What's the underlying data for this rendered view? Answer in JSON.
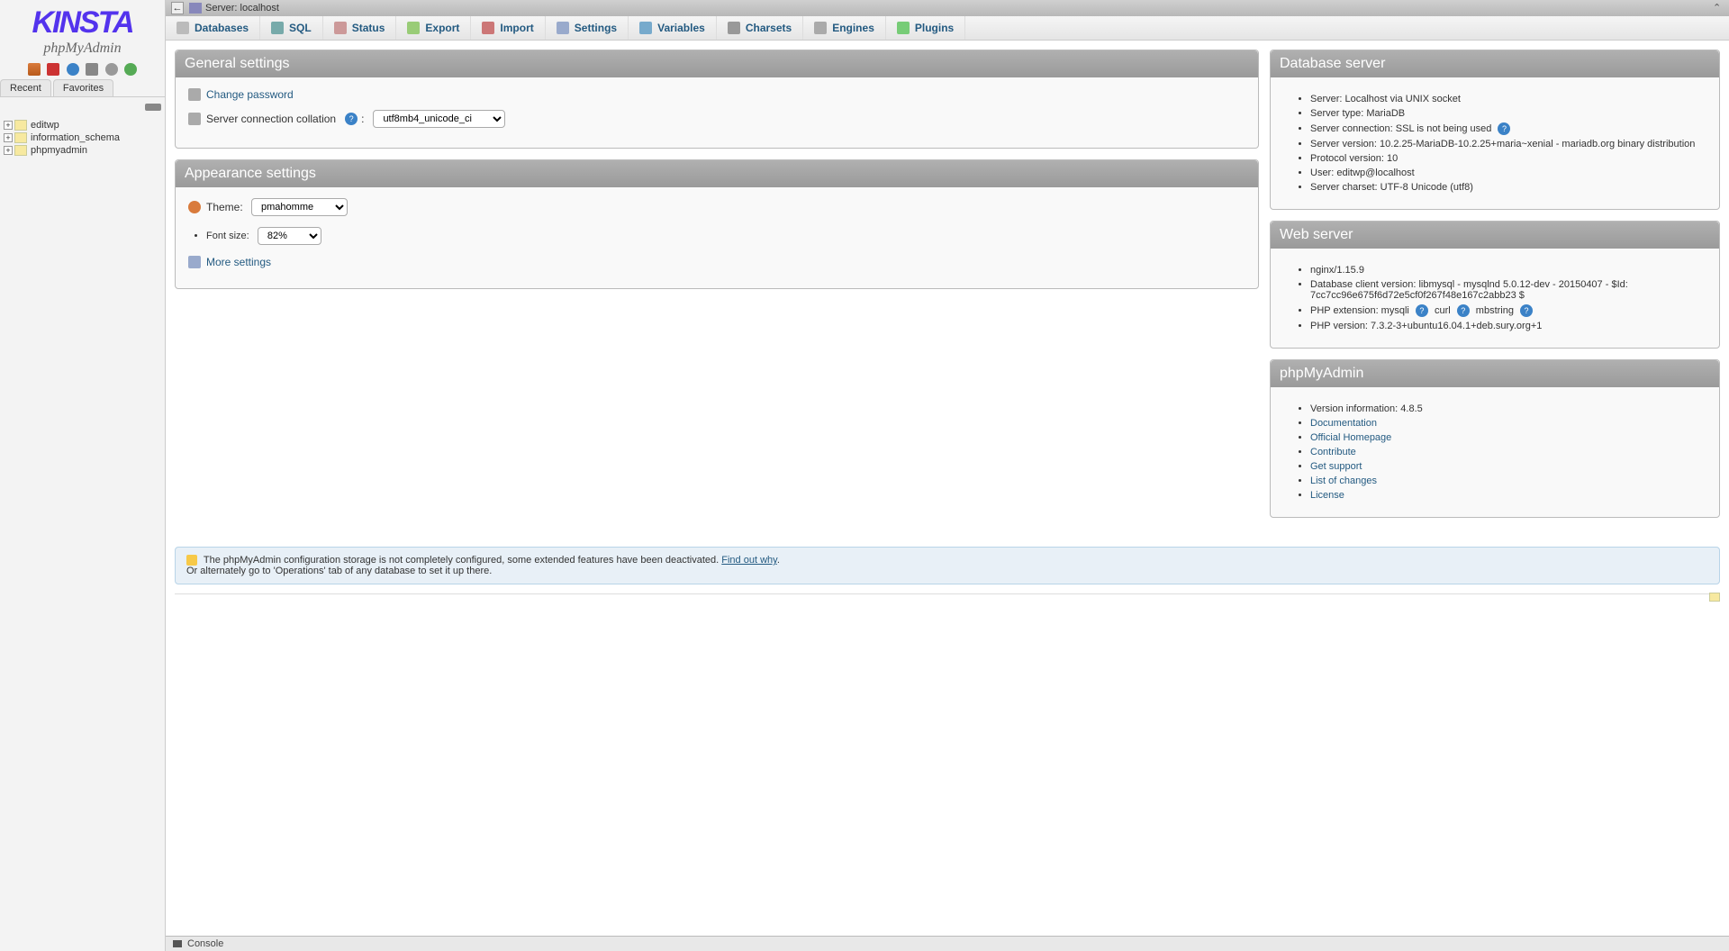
{
  "logo": {
    "brand": "KINSTA",
    "app": "phpMyAdmin"
  },
  "sidebar": {
    "tabs": [
      "Recent",
      "Favorites"
    ],
    "databases": [
      "editwp",
      "information_schema",
      "phpmyadmin"
    ]
  },
  "topbar": {
    "label": "Server: localhost",
    "back": "←"
  },
  "menu": [
    {
      "k": "db",
      "label": "Databases"
    },
    {
      "k": "sql",
      "label": "SQL"
    },
    {
      "k": "status",
      "label": "Status"
    },
    {
      "k": "export",
      "label": "Export"
    },
    {
      "k": "import",
      "label": "Import"
    },
    {
      "k": "settings",
      "label": "Settings"
    },
    {
      "k": "vars",
      "label": "Variables"
    },
    {
      "k": "charsets",
      "label": "Charsets"
    },
    {
      "k": "engines",
      "label": "Engines"
    },
    {
      "k": "plugins",
      "label": "Plugins"
    }
  ],
  "general": {
    "title": "General settings",
    "change_pwd": "Change password",
    "collation_label": "Server connection collation",
    "collation_value": "utf8mb4_unicode_ci"
  },
  "appearance": {
    "title": "Appearance settings",
    "theme_label": "Theme:",
    "theme_value": "pmahomme",
    "font_label": "Font size:",
    "font_value": "82%",
    "more": "More settings"
  },
  "dbserver": {
    "title": "Database server",
    "items": [
      "Server: Localhost via UNIX socket",
      "Server type: MariaDB",
      "Server connection: SSL is not being used",
      "Server version: 10.2.25-MariaDB-10.2.25+maria~xenial - mariadb.org binary distribution",
      "Protocol version: 10",
      "User: editwp@localhost",
      "Server charset: UTF-8 Unicode (utf8)"
    ],
    "ssl_help_index": 2
  },
  "webserver": {
    "title": "Web server",
    "items": [
      "nginx/1.15.9",
      "Database client version: libmysql - mysqlnd 5.0.12-dev - 20150407 - $Id: 7cc7cc96e675f6d72e5cf0f267f48e167c2abb23 $",
      "PHP extension: mysqli",
      "PHP version: 7.3.2-3+ubuntu16.04.1+deb.sury.org+1"
    ],
    "php_ext_extra": [
      "curl",
      "mbstring"
    ]
  },
  "pma": {
    "title": "phpMyAdmin",
    "version": "Version information: 4.8.5",
    "links": [
      "Documentation",
      "Official Homepage",
      "Contribute",
      "Get support",
      "List of changes",
      "License"
    ]
  },
  "notice": {
    "line1": "The phpMyAdmin configuration storage is not completely configured, some extended features have been deactivated.",
    "link": "Find out why",
    "line2": "Or alternately go to 'Operations' tab of any database to set it up there."
  },
  "console": "Console"
}
